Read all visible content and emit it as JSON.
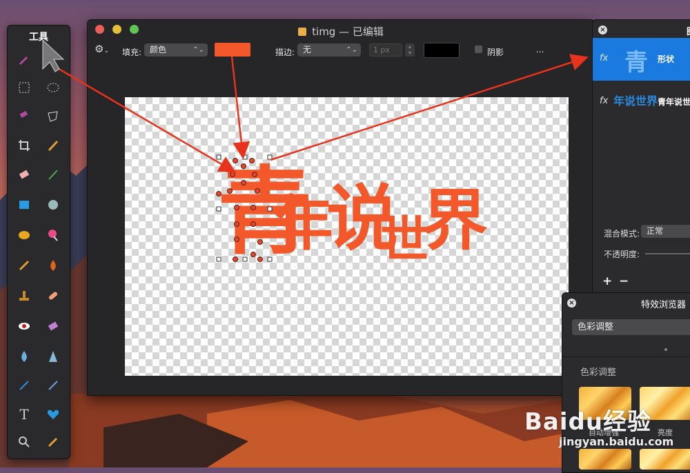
{
  "tools_panel": {
    "title": "工具"
  },
  "window": {
    "title": "timg — 已编辑",
    "toolbar": {
      "fill_label": "填充:",
      "fill_value": "颜色",
      "fill_color": "#f2582a",
      "stroke_label": "描边:",
      "stroke_value": "无",
      "stroke_width_placeholder": "1 px",
      "stroke_color": "#000000",
      "shadow_label": "阴影",
      "more": "..."
    },
    "canvas_text": [
      "青",
      "年",
      "说",
      "世",
      "界"
    ],
    "accent_color": "#f2582a"
  },
  "layers_panel": {
    "title": "图",
    "layers": [
      {
        "fx": "fx",
        "thumb_text": "青",
        "name": "形状",
        "selected": true
      },
      {
        "fx": "fx",
        "thumb_text": "年说世界",
        "name": "青年说世",
        "selected": false
      }
    ],
    "blend_label": "混合模式:",
    "blend_value": "正常",
    "opacity_label": "不透明度:",
    "add": "+",
    "remove": "−"
  },
  "effects_panel": {
    "title": "特效浏览器",
    "category_select": "色彩调整",
    "section_title": "色彩调整",
    "items": [
      "自动增强",
      "亮度"
    ]
  },
  "watermark": {
    "brand": "Baidu经验",
    "url": "jingyan.baidu.com"
  }
}
